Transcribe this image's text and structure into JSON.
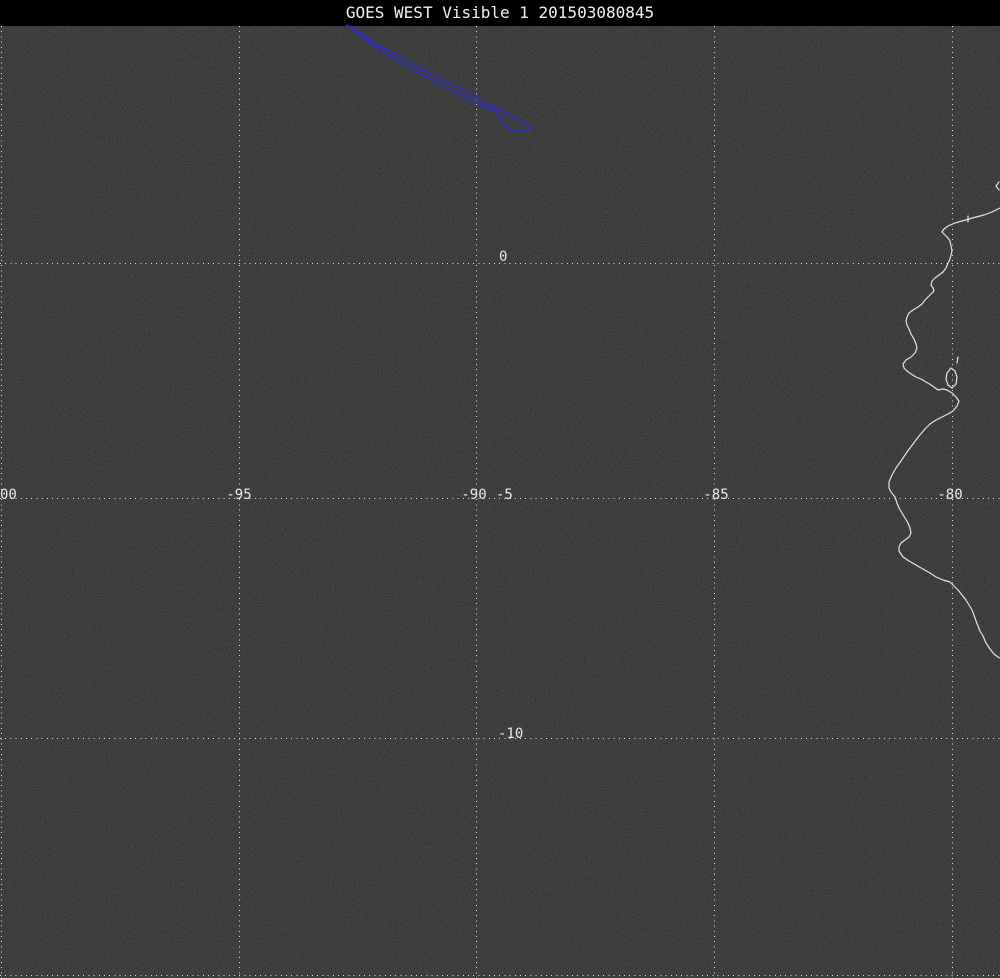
{
  "title": "GOES WEST Visible 1 201503080845",
  "grid": {
    "longitude_labels": [
      {
        "text": "00"
      },
      {
        "text": "-95"
      },
      {
        "text": "-90"
      },
      {
        "text": "-85"
      },
      {
        "text": "-80"
      }
    ],
    "latitude_labels": [
      {
        "text": "0"
      },
      {
        "text": "-5"
      },
      {
        "text": "-10"
      }
    ]
  },
  "colors": {
    "background": "#000000",
    "image_background": "#040404",
    "title_text": "#f2f2f2",
    "grid_line": "#e3e3e3",
    "label_text": "#e9e9e9",
    "coastline": "#e3e3e3",
    "track": "#2b2bd6"
  }
}
